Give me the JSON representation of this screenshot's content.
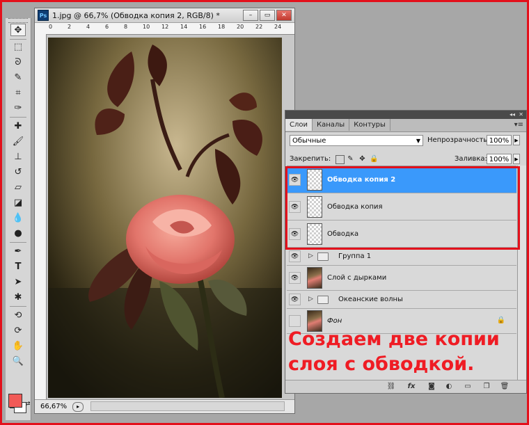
{
  "document": {
    "app_icon": "Ps",
    "title": "1.jpg @ 66,7% (Обводка копия 2, RGB/8) *",
    "buttons": {
      "minimize": "–",
      "restore": "▭",
      "close": "✕"
    },
    "ruler_ticks": [
      "0",
      "2",
      "4",
      "6",
      "8",
      "10",
      "12",
      "14",
      "16",
      "18",
      "20",
      "22",
      "24"
    ],
    "zoom": "66,67%"
  },
  "tools": {
    "icons": [
      "move-tool-icon",
      "marquee-tool-icon",
      "lasso-tool-icon",
      "quick-select-tool-icon",
      "crop-tool-icon",
      "eyedropper-tool-icon",
      "healing-brush-tool-icon",
      "brush-tool-icon",
      "clone-stamp-tool-icon",
      "history-brush-tool-icon",
      "eraser-tool-icon",
      "gradient-tool-icon",
      "blur-tool-icon",
      "dodge-tool-icon",
      "pen-tool-icon",
      "type-tool-icon",
      "path-select-tool-icon",
      "shape-tool-icon",
      "rotate-3d-tool-icon",
      "orbit-3d-tool-icon",
      "hand-tool-icon",
      "zoom-tool-icon"
    ],
    "foreground_color": "#f15a57",
    "background_color": "#ffffff"
  },
  "layers_panel": {
    "tabs": [
      "Слои",
      "Каналы",
      "Контуры"
    ],
    "active_tab": "Слои",
    "blend_mode": "Обычные",
    "opacity_label": "Непрозрачность:",
    "opacity_value": "100%",
    "lock_label": "Закрепить:",
    "fill_label": "Заливка:",
    "fill_value": "100%",
    "layers": [
      {
        "name": "Обводка копия 2",
        "type": "layer",
        "visible": true,
        "selected": true
      },
      {
        "name": "Обводка копия",
        "type": "layer",
        "visible": true,
        "selected": false
      },
      {
        "name": "Обводка",
        "type": "layer",
        "visible": true,
        "selected": false
      },
      {
        "name": "Группа 1",
        "type": "group",
        "visible": true,
        "selected": false
      },
      {
        "name": "Слой с дырками",
        "type": "layer",
        "visible": true,
        "selected": false
      },
      {
        "name": "Океанские волны",
        "type": "group",
        "visible": true,
        "selected": false
      },
      {
        "name": "Фон",
        "type": "background",
        "visible": false,
        "locked": true,
        "selected": false
      }
    ],
    "footer_icons": [
      "link-layers-icon",
      "fx-icon",
      "layer-mask-icon",
      "adjustment-layer-icon",
      "new-group-icon",
      "new-layer-icon",
      "trash-icon"
    ],
    "footer_fx": "fx"
  },
  "annotation": {
    "text": "Создаем две копии слоя с обводкой.",
    "color": "#ef1c24"
  },
  "colors": {
    "selection": "#3a99fb",
    "highlight_border": "#e3101b"
  }
}
